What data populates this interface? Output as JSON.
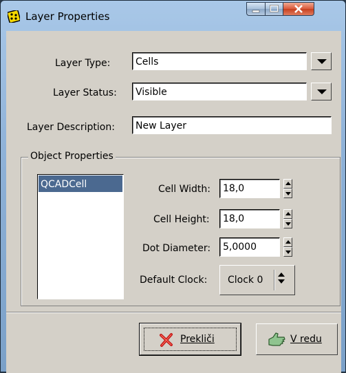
{
  "window": {
    "title": "Layer Properties"
  },
  "form": {
    "layer_type_label": "Layer Type:",
    "layer_type_value": "Cells",
    "layer_status_label": "Layer Status:",
    "layer_status_value": "Visible",
    "layer_description_label": "Layer Description:",
    "layer_description_value": "New Layer"
  },
  "object_properties": {
    "title": "Object Properties",
    "list_items": [
      "QCADCell"
    ],
    "cell_width_label": "Cell Width:",
    "cell_width_value": "18,0",
    "cell_height_label": "Cell Height:",
    "cell_height_value": "18,0",
    "dot_diameter_label": "Dot Diameter:",
    "dot_diameter_value": "5,0000",
    "default_clock_label": "Default Clock:",
    "default_clock_value": "Clock 0"
  },
  "buttons": {
    "cancel_label": "Prekliči",
    "ok_label": "V redu"
  },
  "icons": {
    "app": "qcad-cell-icon",
    "cancel": "cross-icon",
    "ok": "hand-ok-icon"
  },
  "colors": {
    "selection": "#4b6990",
    "dialog_bg": "#d4d0c8",
    "close_button": "#c7401f"
  }
}
